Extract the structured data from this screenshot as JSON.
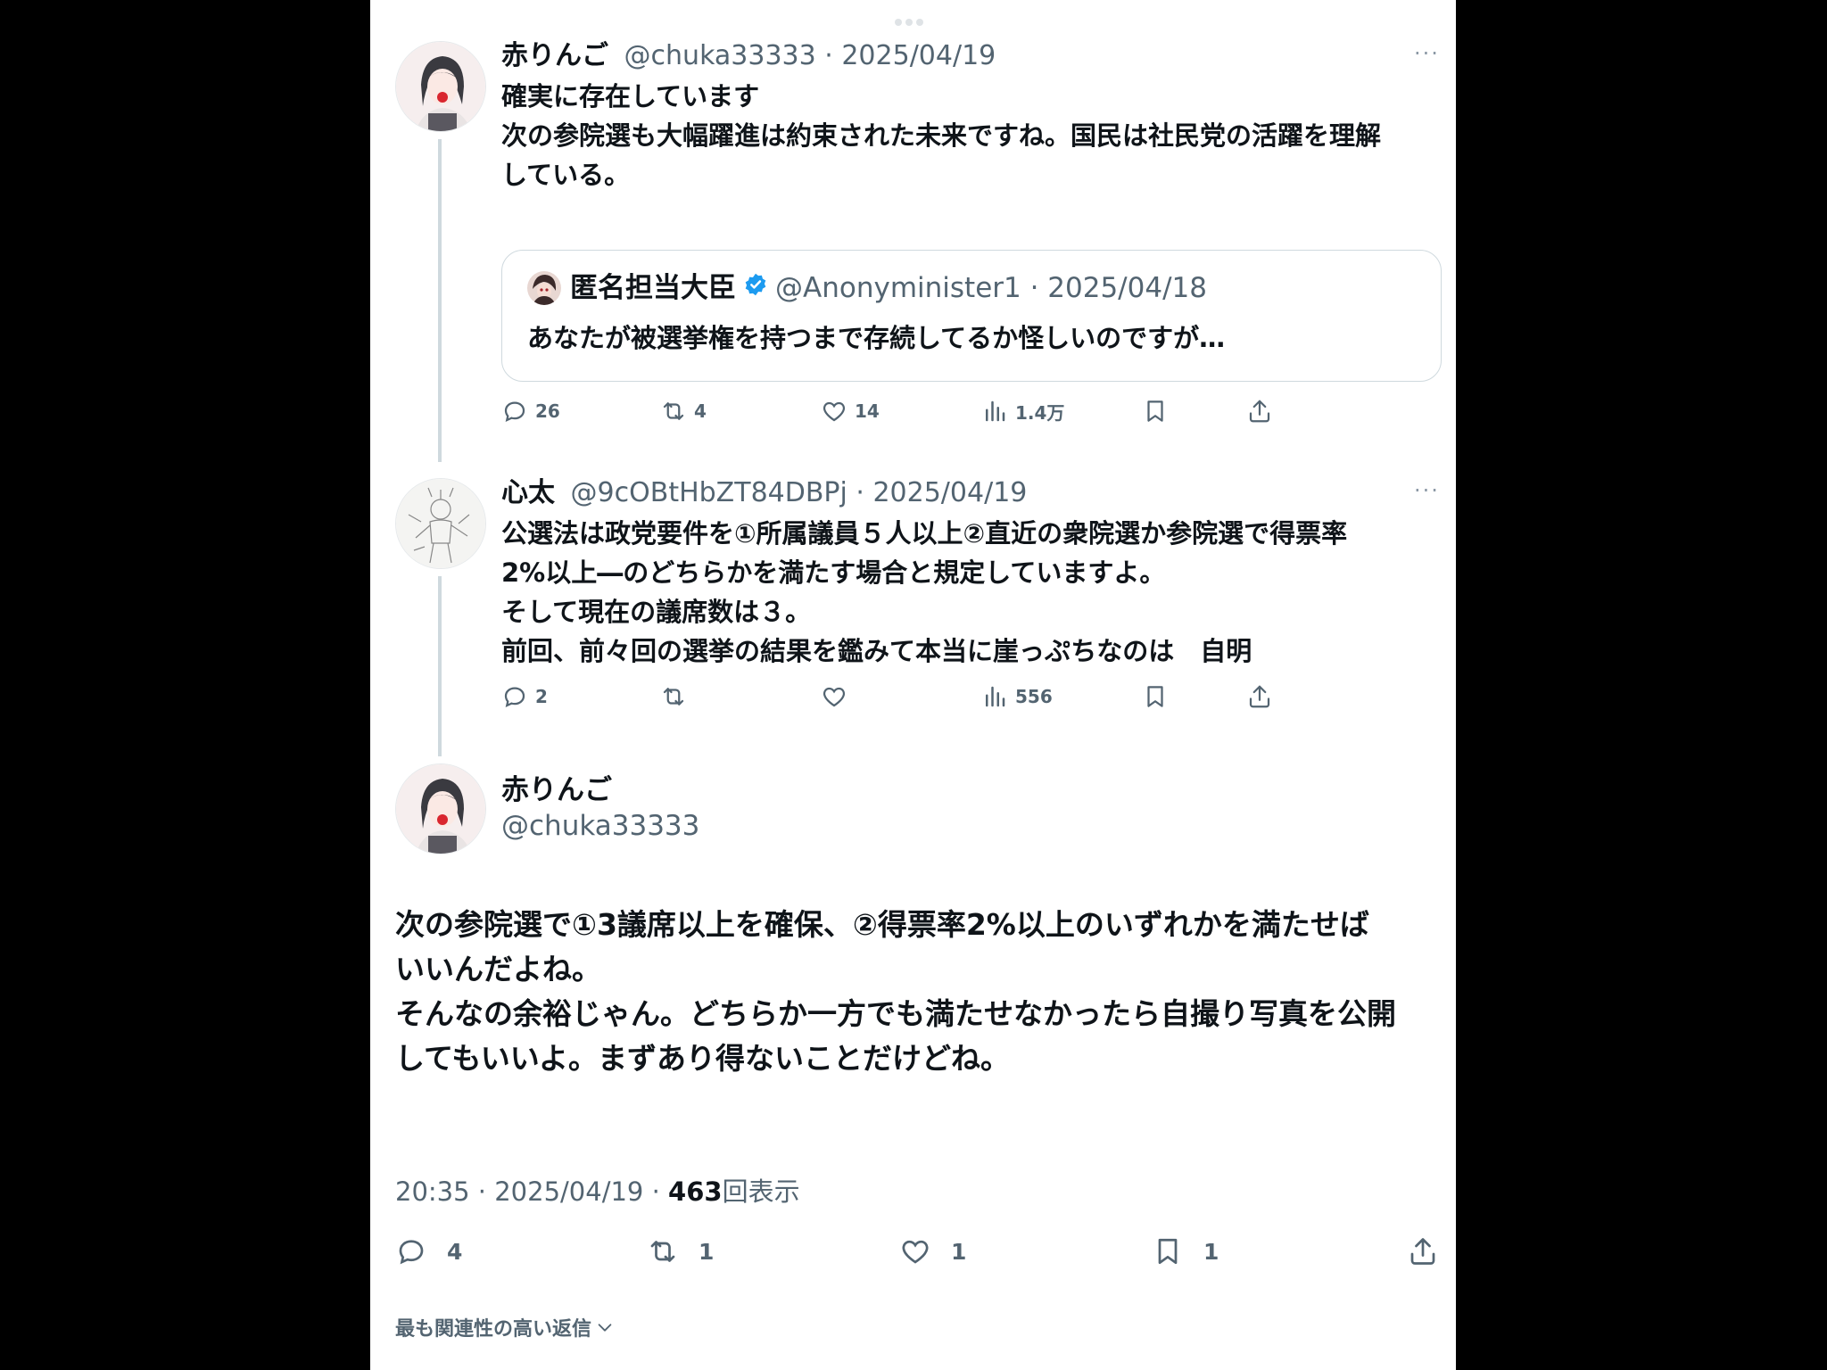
{
  "colors": {
    "text": "#0f1419",
    "muted": "#536471",
    "border": "#cfd9de",
    "verified": "#1d9bf0"
  },
  "tweet1": {
    "name": "赤りんご",
    "handle_date": "@chuka33333 · 2025/04/19",
    "more": "···",
    "body": [
      "確実に存在しています",
      "",
      "次の参院選も大幅躍進は約束された未来ですね。国民は社民党の活躍を理解",
      "している。"
    ],
    "quote": {
      "name": "匿名担当大臣",
      "verified_icon": "verified-badge-icon",
      "handle_date": "@Anonyminister1 · 2025/04/18",
      "text": "あなたが被選挙権を持つまで存続してるか怪しいのですが…"
    },
    "actions": {
      "replies": "26",
      "retweets": "4",
      "likes": "14",
      "views": "1.4万"
    }
  },
  "tweet2": {
    "name": "心太",
    "handle_date": "@9cOBtHbZT84DBPj · 2025/04/19",
    "more": "···",
    "body": [
      "公選法は政党要件を①所属議員５人以上②直近の衆院選か参院選で得票率",
      "2%以上―のどちらかを満たす場合と規定していますよ。",
      "そして現在の議席数は３。",
      "前回、前々回の選挙の結果を鑑みて本当に崖っぷちなのは　自明"
    ],
    "actions": {
      "replies": "2",
      "retweets": "",
      "likes": "",
      "views": "556"
    }
  },
  "main_tweet": {
    "name": "赤りんご",
    "handle": "@chuka33333",
    "body": [
      "次の参院選で①3議席以上を確保、②得票率2%以上のいずれかを満たせば",
      "いいんだよね。",
      "",
      "そんなの余裕じゃん。どちらか一方でも満たせなかったら自撮り写真を公開",
      "してもいいよ。まずあり得ないことだけどね。"
    ],
    "time": "20:35 · 2025/04/19 · ",
    "views": "463",
    "views_label": "回表示",
    "actions": {
      "replies": "4",
      "retweets": "1",
      "likes": "1",
      "bookmarks": "1"
    }
  },
  "sort_label": "最も関連性の高い返信"
}
